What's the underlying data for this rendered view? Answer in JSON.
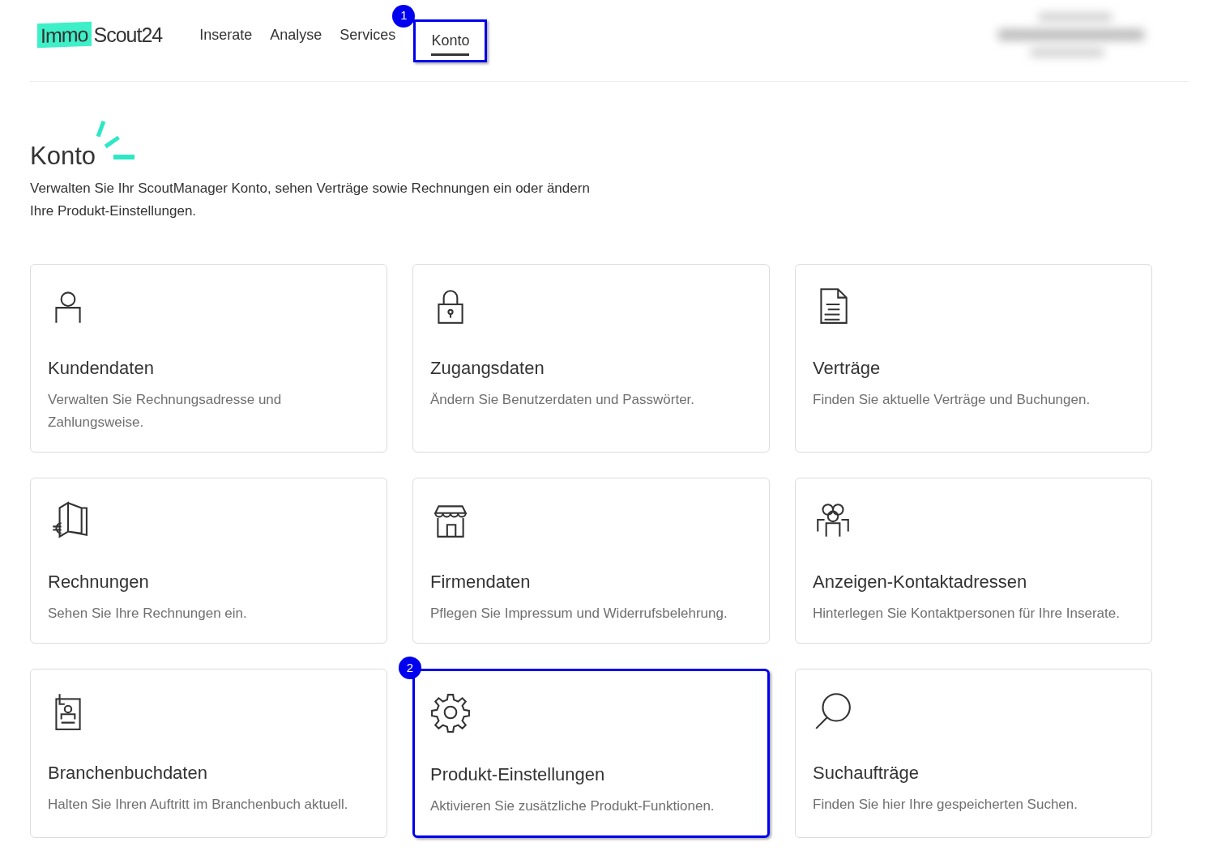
{
  "logo": {
    "part_1": "Immo",
    "part_2": "Scout24"
  },
  "nav": [
    {
      "label": "Inserate",
      "selected": false
    },
    {
      "label": "Analyse",
      "selected": false
    },
    {
      "label": "Services",
      "selected": false
    },
    {
      "label": "Konto",
      "selected": true,
      "callout": "1"
    }
  ],
  "page": {
    "title": "Konto",
    "description": "Verwalten Sie Ihr ScoutManager Konto, sehen Verträge sowie Rechnungen ein oder ändern Ihre Produkt-Einstellungen."
  },
  "cards": [
    {
      "title": "Kundendaten",
      "description": "Verwalten Sie Rechnungsadresse und Zahlungsweise."
    },
    {
      "title": "Zugangsdaten",
      "description": "Ändern Sie Benutzerdaten und Passwörter."
    },
    {
      "title": "Verträge",
      "description": "Finden Sie aktuelle Verträge und Buchungen."
    },
    {
      "title": "Rechnungen",
      "description": "Sehen Sie Ihre Rechnungen ein."
    },
    {
      "title": "Firmendaten",
      "description": "Pflegen Sie Impressum und Widerrufsbelehrung."
    },
    {
      "title": "Anzeigen-Kontaktadressen",
      "description": "Hinterlegen Sie Kontaktpersonen für Ihre Inserate."
    },
    {
      "title": "Branchenbuchdaten",
      "description": "Halten Sie Ihren Auftritt im Branchenbuch aktuell."
    },
    {
      "title": "Produkt-Einstellungen",
      "description": "Aktivieren Sie zusätzliche Produkt-Funktionen.",
      "callout": "2"
    },
    {
      "title": "Suchaufträge",
      "description": "Finden Sie hier Ihre gespeicherten Suchen."
    }
  ]
}
